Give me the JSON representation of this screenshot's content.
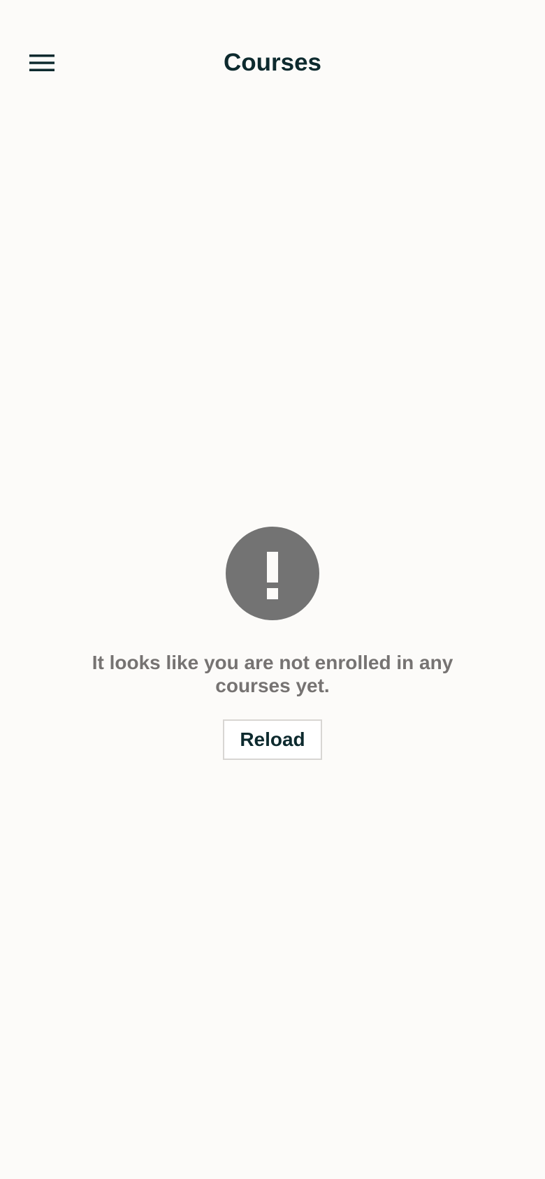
{
  "header": {
    "title": "Courses",
    "menu_icon": "hamburger-menu-icon"
  },
  "empty_state": {
    "icon": "exclamation-circle-icon",
    "message": "It looks like you are not enrolled in any courses yet.",
    "reload_label": "Reload"
  },
  "colors": {
    "background": "#fcfbf9",
    "title_text": "#0d2a2e",
    "icon_gray": "#737373",
    "message_text": "#767372",
    "button_border": "#d8d6d3"
  }
}
